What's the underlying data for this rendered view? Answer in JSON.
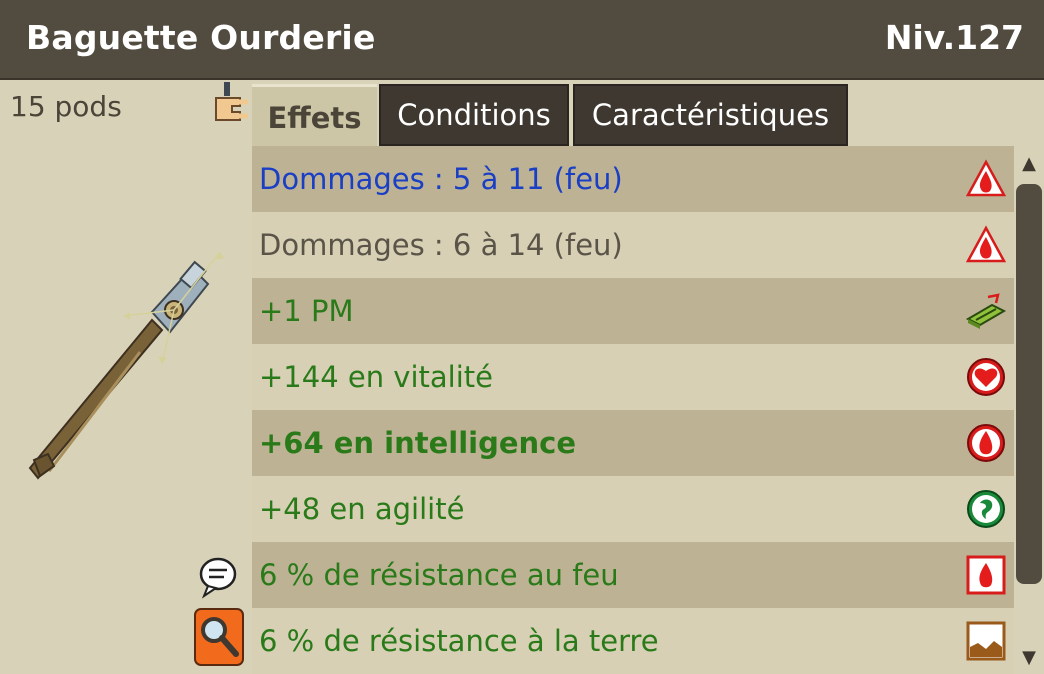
{
  "item": {
    "name": "Baguette Ourderie",
    "level": "Niv.127",
    "weight": "15 pods"
  },
  "icons": {
    "hand": "equip-hand-icon",
    "chat": "chat-bubble-icon",
    "magnifier": "magnifier-icon",
    "weapon": "wand-weapon-image"
  },
  "tabs": [
    {
      "label": "Effets",
      "active": true
    },
    {
      "label": "Conditions",
      "active": false
    },
    {
      "label": "Caractéristiques",
      "active": false
    }
  ],
  "effects": [
    {
      "text": "Dommages : 5 à 11 (feu)",
      "icon": "fire-triangle-icon"
    },
    {
      "text": "Dommages : 6 à 14 (feu)",
      "icon": "fire-triangle-icon"
    },
    {
      "text": "+1 PM",
      "icon": "movement-point-icon"
    },
    {
      "text": "+144 en vitalité",
      "icon": "heart-circle-icon"
    },
    {
      "text": "+64 en intelligence",
      "icon": "fire-circle-icon"
    },
    {
      "text": "+48 en agilité",
      "icon": "air-circle-icon"
    },
    {
      "text": "6 % de résistance au feu",
      "icon": "fire-square-icon"
    },
    {
      "text": "6 % de résistance à la terre",
      "icon": "earth-square-icon"
    }
  ],
  "colors": {
    "header": "#524b3f",
    "panel": "#d8d3b8",
    "row_dark": "#bdb394",
    "row_light": "#d7d0b5",
    "text_green": "#2a7a1a",
    "text_blue": "#1a3fc4",
    "text_grey": "#5a5448"
  },
  "scrollbar": {
    "up": "▲",
    "down": "▼"
  }
}
